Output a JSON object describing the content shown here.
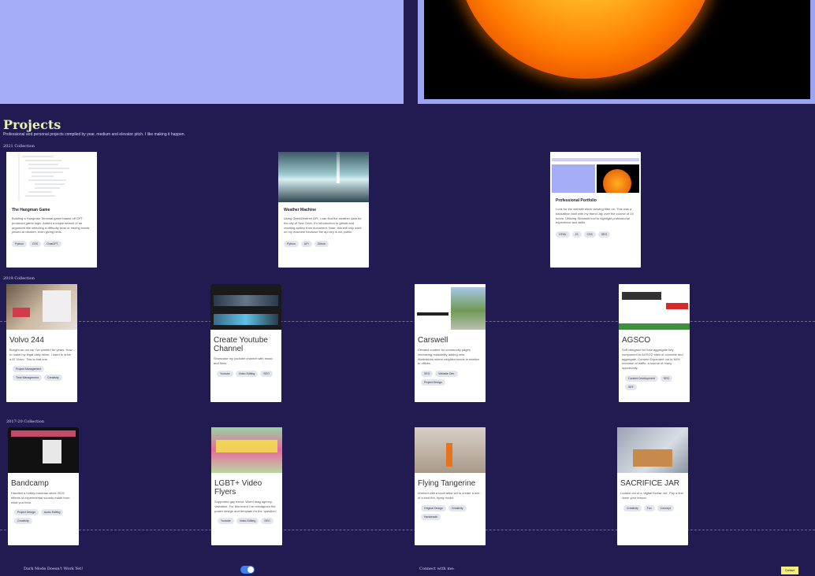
{
  "header": {
    "title": "Projects",
    "subtitle": "Professional and personal projects compiled by year, medium and elevator pitch. I like making it happen."
  },
  "sections": {
    "s2021": "2021 Collection",
    "s2019": "2019 Collection",
    "s2017": "2017-20 Collection"
  },
  "cards2021": [
    {
      "title": "The Hangman Game",
      "desc": "Building a Hangman Terminal game based off GPT produced game logic. Added a maple search of an argument like selecting a difficulty level or having words picked at random, even giving hints.",
      "tags": [
        "Python",
        "CSS",
        "ChatGPT"
      ]
    },
    {
      "title": "Weather Machine",
      "desc": "Using OpenWeather API, I can find the weather data for the city of Sea Cave. It's introduction to github and creating apikey from document. Note: this will only work on my machine because the api key is not public.",
      "tags": [
        "Python",
        "API",
        "Github"
      ]
    },
    {
      "title": "Professional Portfolio",
      "desc": "Look for the website stock viewing filter on. This was a hackathon built with my friend Jay over the course of 24 hours. Utilizing Streamlit tool to highlight professional experience and skills.",
      "tags": [
        "HTML",
        "JS",
        "CSS",
        "SEO"
      ]
    }
  ],
  "cards2019": [
    {
      "title": "Volvo 244",
      "desc": "Bought an old car I've wanted for years. How to make my legal daily driver. I used to drive a 87 Volvo. This is that one.",
      "tags": [
        "Project Management",
        "Time Management",
        "Creativity"
      ]
    },
    {
      "title": "Create Youtube Channel",
      "desc": "Showcase my youtube channel with music and films.",
      "tags": [
        "Youtube",
        "Video Editing",
        "SEO"
      ]
    },
    {
      "title": "Carswell",
      "desc": "Created content for community pages increasing readability adding new illustrations where neighborhoods in relation to offices.",
      "tags": [
        "SEO",
        "Website Dev.",
        "Project Design"
      ]
    },
    {
      "title": "AGSCO",
      "desc": "Soft designed for fuse aggregate key component to AGSCO sites of concrete and aggregate. Content Expanded out to 60% increase of traffic, a source of many opportunity.",
      "tags": [
        "Content Development",
        "SEO",
        "SEF"
      ]
    }
  ],
  "cards2017": [
    {
      "title": "Bandcamp",
      "desc": "Handled a hobby musician since 2015 effects of experimental sounds made from what you hear.",
      "tags": [
        "Project Design",
        "Audio Editing",
        "Creativity"
      ]
    },
    {
      "title": "LGBT+ Video Flyers",
      "desc": "Supported gay friend. Weird drag agency, Valentine. For this event I've reimagined the poster design and template for the 'question'.",
      "tags": [
        "Youtube",
        "Video Editing",
        "SEO"
      ]
    },
    {
      "title": "Flying Tangerine",
      "desc": "Worked with a local artist set to create a one of a kind fire, flying model.",
      "tags": [
        "Original Design",
        "Creativity",
        "Handmade"
      ]
    },
    {
      "title": "SACRIFICE JAR",
      "desc": "Looked out of a 'digital Swear Jar'. Pay a fine - learn your lesson.",
      "tags": [
        "Creativity",
        "Fun",
        "Concept"
      ]
    }
  ],
  "footer": {
    "dark_mode_label": "Dark Mode Doesn't Work Yet!",
    "connect_label": "Connect with me:",
    "button_label": "Contact"
  },
  "colors": {
    "background": "#211b52",
    "hero_left": "#a4adf6",
    "hero_right": "#9ba4f0",
    "title": "#e8f1b0",
    "toggle": "#3b82f6",
    "footer_button": "#f3ee7a"
  }
}
